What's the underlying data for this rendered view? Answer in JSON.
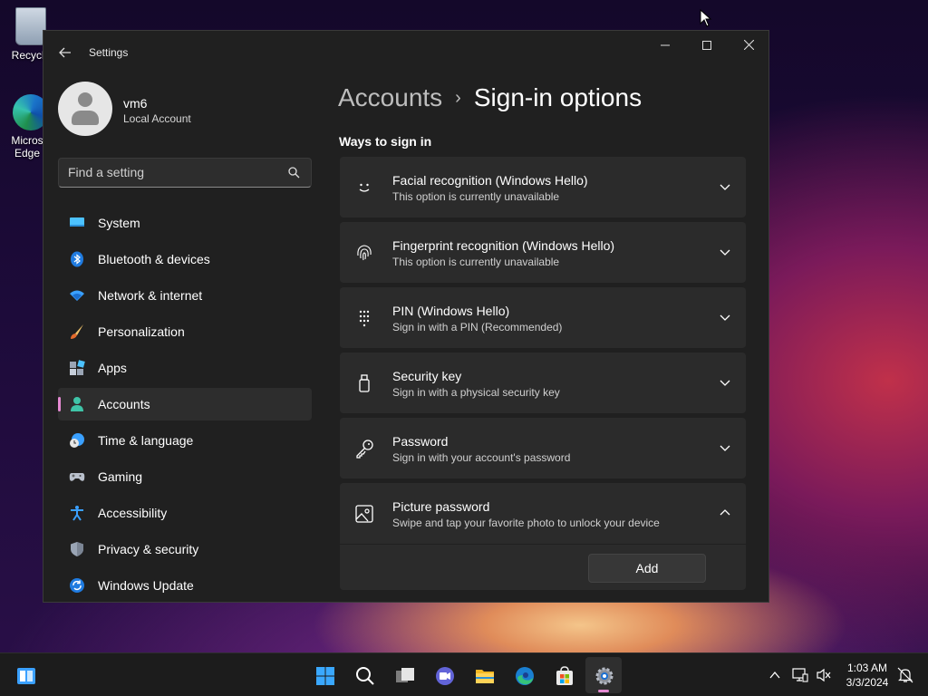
{
  "desktop": {
    "icons": [
      {
        "label": "Recycle"
      },
      {
        "label": "Micros Edge"
      }
    ]
  },
  "window": {
    "title": "Settings",
    "controls": {
      "minimize": "—",
      "maximize": "☐",
      "close": "✕"
    }
  },
  "profile": {
    "name": "vm6",
    "type": "Local Account"
  },
  "search": {
    "placeholder": "Find a setting"
  },
  "nav": {
    "items": [
      {
        "label": "System",
        "icon": "system-icon"
      },
      {
        "label": "Bluetooth & devices",
        "icon": "bluetooth-icon"
      },
      {
        "label": "Network & internet",
        "icon": "wifi-icon"
      },
      {
        "label": "Personalization",
        "icon": "brush-icon"
      },
      {
        "label": "Apps",
        "icon": "apps-icon"
      },
      {
        "label": "Accounts",
        "icon": "accounts-icon",
        "active": true
      },
      {
        "label": "Time & language",
        "icon": "clock-globe-icon"
      },
      {
        "label": "Gaming",
        "icon": "gamepad-icon"
      },
      {
        "label": "Accessibility",
        "icon": "accessibility-icon"
      },
      {
        "label": "Privacy & security",
        "icon": "shield-icon"
      },
      {
        "label": "Windows Update",
        "icon": "update-icon"
      }
    ]
  },
  "main": {
    "breadcrumb": {
      "parent": "Accounts",
      "separator": "›",
      "current": "Sign-in options"
    },
    "section_title": "Ways to sign in",
    "cards": [
      {
        "title": "Facial recognition (Windows Hello)",
        "subtitle": "This option is currently unavailable",
        "icon": "face-icon",
        "expanded": false
      },
      {
        "title": "Fingerprint recognition (Windows Hello)",
        "subtitle": "This option is currently unavailable",
        "icon": "fingerprint-icon",
        "expanded": false
      },
      {
        "title": "PIN (Windows Hello)",
        "subtitle": "Sign in with a PIN (Recommended)",
        "icon": "pin-keypad-icon",
        "expanded": false
      },
      {
        "title": "Security key",
        "subtitle": "Sign in with a physical security key",
        "icon": "usb-key-icon",
        "expanded": false
      },
      {
        "title": "Password",
        "subtitle": "Sign in with your account's password",
        "icon": "key-icon",
        "expanded": false
      },
      {
        "title": "Picture password",
        "subtitle": "Swipe and tap your favorite photo to unlock your device",
        "icon": "picture-icon",
        "expanded": true
      }
    ],
    "picture_password_button": "Add"
  },
  "taskbar": {
    "time": "1:03 AM",
    "date": "3/3/2024"
  },
  "colors": {
    "accent": "#e58ad2",
    "window_bg": "#202020",
    "card_bg": "#2b2b2b",
    "taskbar_bg": "#1c1c1c"
  }
}
